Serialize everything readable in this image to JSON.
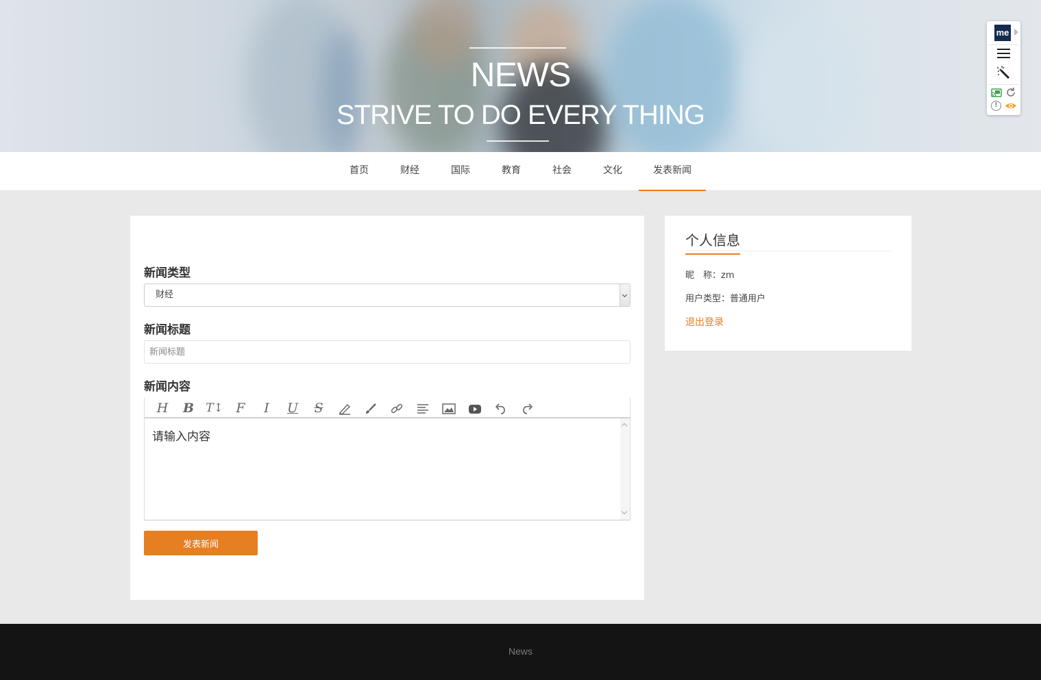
{
  "hero": {
    "title": "NEWS",
    "subtitle": "STRIVE TO DO EVERY THING"
  },
  "plugin": {
    "logo_text": "me",
    "icons": [
      "menu-icon",
      "magic-wand-icon",
      "cast-icon",
      "refresh-icon",
      "warning-icon",
      "eye-icon"
    ]
  },
  "nav": {
    "items": [
      {
        "label": "首页"
      },
      {
        "label": "财经"
      },
      {
        "label": "国际"
      },
      {
        "label": "教育"
      },
      {
        "label": "社会"
      },
      {
        "label": "文化"
      },
      {
        "label": "发表新闻",
        "active": true
      }
    ]
  },
  "form": {
    "type_label": "新闻类型",
    "type_value": "财经",
    "title_label": "新闻标题",
    "title_placeholder": "新闻标题",
    "content_label": "新闻内容",
    "toolbar": [
      "heading-icon",
      "bold-icon",
      "font-size-icon",
      "font-family-icon",
      "italic-icon",
      "underline-icon",
      "strikethrough-icon",
      "highlight-icon",
      "brush-icon",
      "link-icon",
      "align-icon",
      "image-icon",
      "video-icon",
      "undo-icon",
      "redo-icon"
    ],
    "content_placeholder": "请输入内容",
    "submit_label": "发表新闻"
  },
  "profile": {
    "title": "个人信息",
    "nickname_label": "昵　称：",
    "nickname": "zm",
    "usertype_label": "用户类型：",
    "usertype": "普通用户",
    "logout_label": "退出登录"
  },
  "footer": {
    "text": "News"
  },
  "colors": {
    "accent": "#e67e22",
    "footer_bg": "#141414",
    "page_bg": "#e9e9e9"
  }
}
